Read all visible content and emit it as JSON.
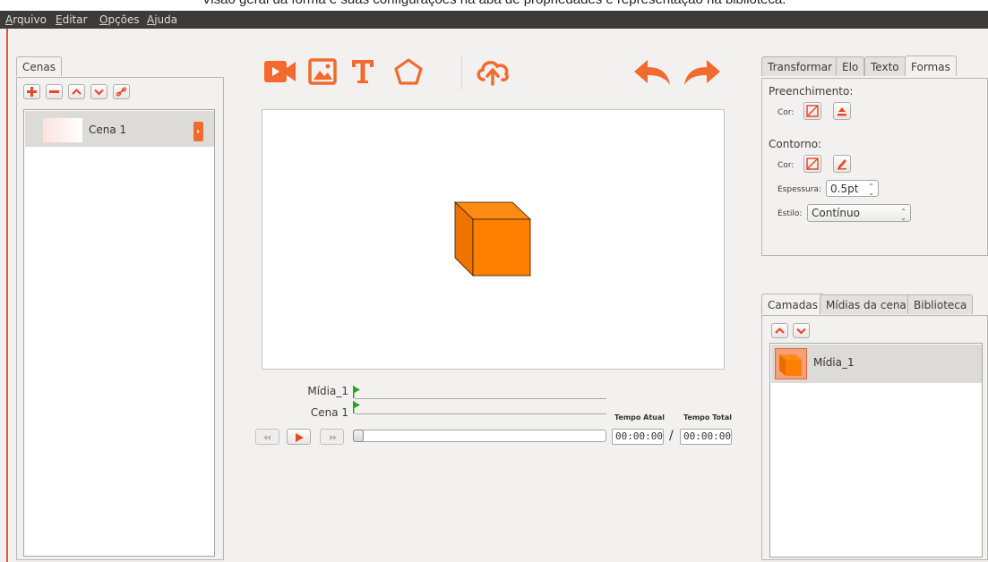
{
  "caption": "Visão geral da forma e suas configurações na aba de propriedades e representação na biblioteca.",
  "menu": [
    {
      "label": "Arquivo",
      "accel": "A",
      "rest": "rquivo"
    },
    {
      "label": "Editar",
      "accel": "E",
      "rest": "ditar"
    },
    {
      "label": "Opções",
      "accel": "O",
      "rest": "pções"
    },
    {
      "label": "Ajuda",
      "accel": "A",
      "rest": "juda"
    }
  ],
  "scenes_panel": {
    "tab": "Cenas",
    "items": [
      {
        "label": "Cena 1"
      }
    ]
  },
  "timeline": {
    "rows": [
      "Mídia_1",
      "Cena 1"
    ],
    "current_time_label": "Tempo Atual",
    "total_time_label": "Tempo Total",
    "current_time": "00:00:00",
    "separator": "/",
    "total_time": "00:00:00"
  },
  "properties": {
    "tabs": [
      "Transformar",
      "Elo",
      "Texto",
      "Formas"
    ],
    "active_tab": "Formas",
    "fill_heading": "Preenchimento:",
    "fill_color_label": "Cor:",
    "stroke_heading": "Contorno:",
    "stroke_color_label": "Cor:",
    "thickness_label": "Espessura:",
    "thickness_value": "0.5pt",
    "style_label": "Estilo:",
    "style_value": "Contínuo"
  },
  "layers_panel": {
    "tabs": [
      "Camadas",
      "Mídias da cena",
      "Biblioteca"
    ],
    "active_tab": "Camadas",
    "items": [
      {
        "label": "Mídia_1"
      }
    ]
  },
  "colors": {
    "accent": "#f26a2e",
    "cube_front": "#ff8000",
    "menubar": "#3c3b37",
    "flag": "#2e9d2e"
  }
}
